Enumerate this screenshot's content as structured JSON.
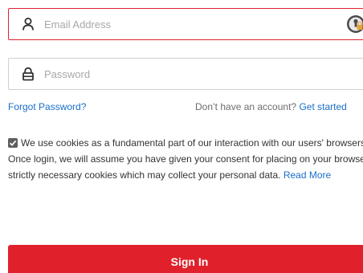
{
  "email": {
    "placeholder": "Email Address",
    "icon": "user-icon",
    "accessory_icon": "password-manager-icon"
  },
  "password": {
    "placeholder": "Password",
    "icon": "lock-icon"
  },
  "links": {
    "forgot_password": "Forgot Password?",
    "no_account": "Don’t have an account?",
    "get_started": "Get started"
  },
  "consent": {
    "checked": true,
    "text": "We use cookies as a fundamental part of our interaction with our users' browsers. Once login, we will assume you have given your consent for placing on your browser strictly necessary cookies which may collect your personal data.",
    "read_more": "Read More"
  },
  "sign_in": {
    "label": "Sign In"
  },
  "colors": {
    "accent_red": "#e0212b",
    "link_blue": "#1a6fc9"
  }
}
